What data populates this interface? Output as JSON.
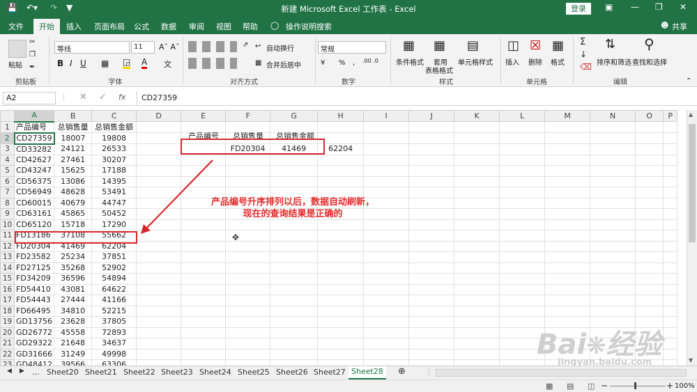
{
  "titlebar": {
    "title": "新建 Microsoft Excel 工作表 - Excel",
    "login": "登录"
  },
  "menu": [
    "文件",
    "开始",
    "插入",
    "页面布局",
    "公式",
    "数据",
    "审阅",
    "视图",
    "帮助",
    "操作说明搜索"
  ],
  "share": "共享",
  "ribbon": {
    "paste": "粘贴",
    "clipboard": "剪贴板",
    "font_name": "等线",
    "font_size": "11",
    "font_group": "字体",
    "wrap": "自动换行",
    "merge": "合并后居中",
    "align_group": "对齐方式",
    "numfmt": "常规",
    "number_group": "数字",
    "pct": "%",
    "cond": "条件格式",
    "table_fmt1": "套用",
    "table_fmt2": "表格格式",
    "cell_style": "单元格样式",
    "styles_group": "样式",
    "insert": "插入",
    "delete": "删除",
    "format": "格式",
    "cells_group": "单元格",
    "sort": "排序和筛选",
    "find": "查找和选择",
    "edit_group": "编辑"
  },
  "formula_bar": {
    "name_box": "A2",
    "fx": "fx",
    "value": "CD27359"
  },
  "columns": [
    "A",
    "B",
    "C",
    "D",
    "E",
    "F",
    "G",
    "H",
    "I",
    "J",
    "K",
    "L",
    "M",
    "N",
    "O",
    "P"
  ],
  "rows": [
    [
      "1",
      "产品编号",
      "总销售量",
      "总销售金额",
      "",
      "",
      "",
      "",
      "",
      ""
    ],
    [
      "2",
      "CD27359",
      "18007",
      "19808",
      "",
      "",
      "",
      "",
      "",
      ""
    ],
    [
      "3",
      "CD33282",
      "24121",
      "26533",
      "",
      "",
      "FD20304",
      "41469",
      "62204",
      ""
    ],
    [
      "4",
      "CD42627",
      "27461",
      "30207",
      "",
      "",
      "",
      "",
      "",
      ""
    ],
    [
      "5",
      "CD43247",
      "15625",
      "17188",
      "",
      "",
      "",
      "",
      "",
      ""
    ],
    [
      "6",
      "CD56375",
      "13086",
      "14395",
      "",
      "",
      "",
      "",
      "",
      ""
    ],
    [
      "7",
      "CD56949",
      "48628",
      "53491",
      "",
      "",
      "",
      "",
      "",
      ""
    ],
    [
      "8",
      "CD60015",
      "40679",
      "44747",
      "",
      "",
      "",
      "",
      "",
      ""
    ],
    [
      "9",
      "CD63161",
      "45865",
      "50452",
      "",
      "",
      "",
      "",
      "",
      ""
    ],
    [
      "10",
      "CD65120",
      "15718",
      "17290",
      "",
      "",
      "",
      "",
      "",
      ""
    ],
    [
      "11",
      "FD13186",
      "37108",
      "55662",
      "",
      "",
      "",
      "",
      "",
      ""
    ],
    [
      "12",
      "FD20304",
      "41469",
      "62204",
      "",
      "",
      "",
      "",
      "",
      ""
    ],
    [
      "13",
      "FD23582",
      "25234",
      "37851",
      "",
      "",
      "",
      "",
      "",
      ""
    ],
    [
      "14",
      "FD27125",
      "35268",
      "52902",
      "",
      "",
      "",
      "",
      "",
      ""
    ],
    [
      "15",
      "FD34209",
      "36596",
      "54894",
      "",
      "",
      "",
      "",
      "",
      ""
    ],
    [
      "16",
      "FD54410",
      "43081",
      "64622",
      "",
      "",
      "",
      "",
      "",
      ""
    ],
    [
      "17",
      "FD54443",
      "27444",
      "41166",
      "",
      "",
      "",
      "",
      "",
      ""
    ],
    [
      "18",
      "FD66495",
      "34810",
      "52215",
      "",
      "",
      "",
      "",
      "",
      ""
    ],
    [
      "19",
      "GD13756",
      "23628",
      "37805",
      "",
      "",
      "",
      "",
      "",
      ""
    ],
    [
      "20",
      "GD26772",
      "45558",
      "72893",
      "",
      "",
      "",
      "",
      "",
      ""
    ],
    [
      "21",
      "GD29322",
      "21648",
      "34637",
      "",
      "",
      "",
      "",
      "",
      ""
    ],
    [
      "22",
      "GD31666",
      "31249",
      "49998",
      "",
      "",
      "",
      "",
      "",
      ""
    ],
    [
      "23",
      "GD48412",
      "39566",
      "63306",
      "",
      "",
      "",
      "",
      "",
      ""
    ],
    [
      "24",
      "GD55130",
      "40872",
      "65395",
      "",
      "",
      "",
      "",
      "",
      ""
    ]
  ],
  "query_headers": [
    "产品编号",
    "总销售量",
    "总销售金额"
  ],
  "annotation": {
    "line1": "产品编号升序排列以后，数据自动刷新，",
    "line2": "现在的查询结果是正确的"
  },
  "sheets": [
    "...",
    "Sheet20",
    "Sheet21",
    "Sheet22",
    "Sheet23",
    "Sheet24",
    "Sheet25",
    "Sheet26",
    "Sheet27",
    "Sheet28"
  ],
  "zoom": "100%",
  "watermark": {
    "brand": "Bai",
    "brand2": "经验",
    "url": "jingyan.baidu.com"
  }
}
